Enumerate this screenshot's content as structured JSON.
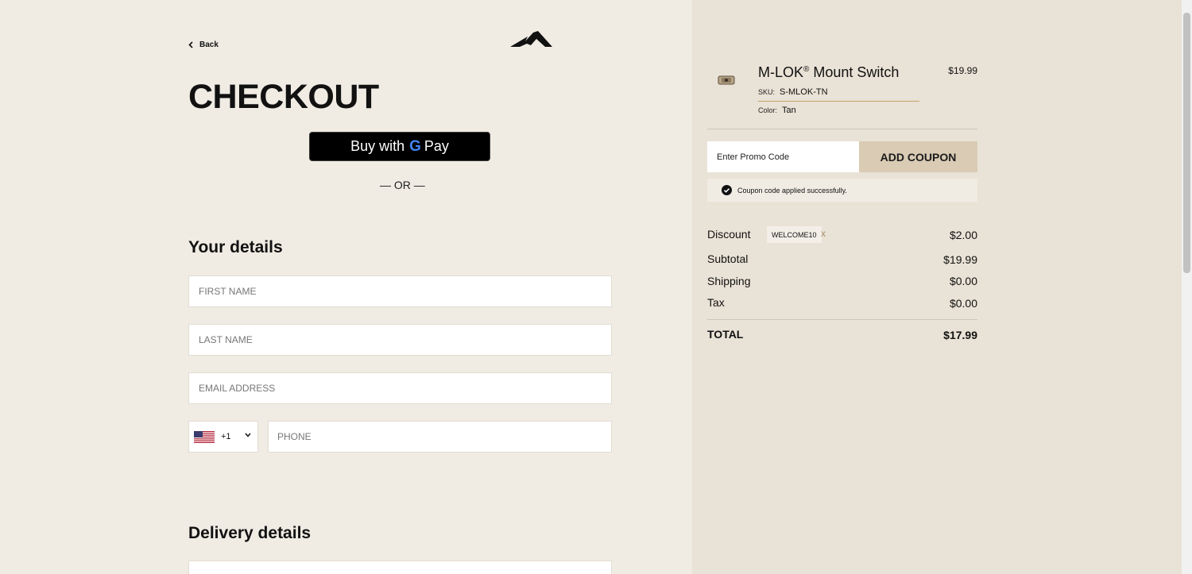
{
  "header": {
    "back_label": "Back",
    "title": "CHECKOUT"
  },
  "express": {
    "gpay_prefix": "Buy with",
    "gpay_g": "G",
    "gpay_suffix": "Pay",
    "or_label": "— OR —"
  },
  "details": {
    "title": "Your details",
    "first_name_placeholder": "FIRST NAME",
    "last_name_placeholder": "LAST NAME",
    "email_placeholder": "EMAIL ADDRESS",
    "country_code": "+1",
    "phone_placeholder": "PHONE"
  },
  "delivery": {
    "title": "Delivery details"
  },
  "cart": {
    "product_name": "M-LOK",
    "product_name_mark": "®",
    "product_name_rest": " Mount Switch",
    "price": "$19.99",
    "sku_label": "SKU:",
    "sku_value": "S-MLOK-TN",
    "color_label": "Color:",
    "color_value": "Tan"
  },
  "promo": {
    "placeholder": "Enter Promo Code",
    "button_label": "ADD COUPON",
    "success_message": "Coupon code applied successfully."
  },
  "summary": {
    "discount_label": "Discount",
    "discount_code": "WELCOME10",
    "discount_remove": "x",
    "discount_value": "$2.00",
    "subtotal_label": "Subtotal",
    "subtotal_value": "$19.99",
    "shipping_label": "Shipping",
    "shipping_value": "$0.00",
    "tax_label": "Tax",
    "tax_value": "$0.00",
    "total_label": "TOTAL",
    "total_value": "$17.99"
  },
  "colors": {
    "left_bg": "#f0ebe3",
    "right_bg": "#e9e2d6",
    "coupon_button": "#d9cbb4",
    "sku_underline": "#c9a06a"
  }
}
